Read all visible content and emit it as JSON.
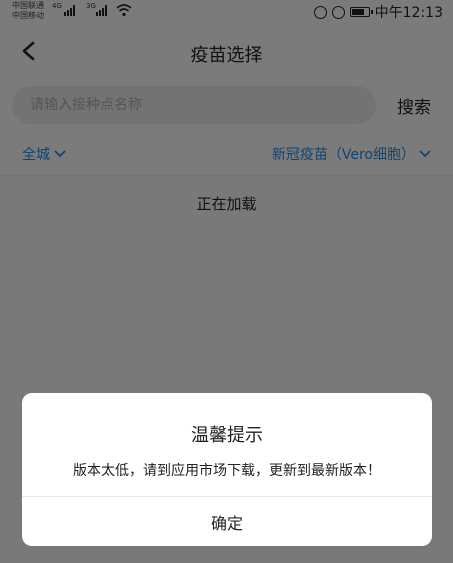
{
  "status_bar": {
    "carrier_top": "中国联通",
    "carrier_bottom": "中国移动",
    "net_label_1": "4G",
    "net_label_2": "3G",
    "time": "中午12:13",
    "battery_level": 0.7
  },
  "header": {
    "title": "疫苗选择"
  },
  "search": {
    "placeholder": "请输入接种点名称",
    "button_label": "搜索"
  },
  "filters": {
    "region": "全城",
    "vaccine": "新冠疫苗（Vero细胞）"
  },
  "content": {
    "loading_text": "正在加载"
  },
  "dialog": {
    "title": "温馨提示",
    "message": "版本太低，请到应用市场下载，更新到最新版本！",
    "confirm_label": "确定"
  },
  "colors": {
    "accent": "#1e88e5",
    "overlay": "rgba(0,0,0,0.5)"
  }
}
